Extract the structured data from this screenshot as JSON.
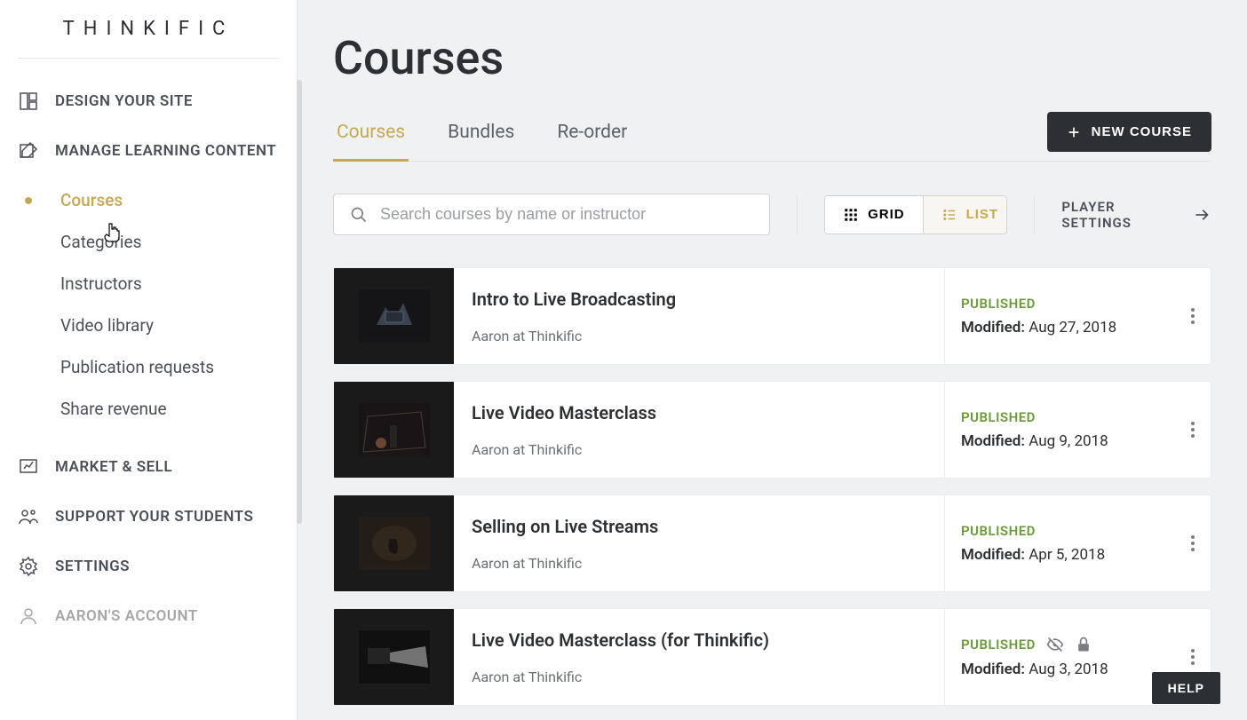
{
  "brand": "THINKIFIC",
  "sidebar": {
    "sections": [
      {
        "label": "DESIGN YOUR SITE"
      },
      {
        "label": "MANAGE LEARNING CONTENT"
      },
      {
        "label": "MARKET & SELL"
      },
      {
        "label": "SUPPORT YOUR STUDENTS"
      },
      {
        "label": "SETTINGS"
      },
      {
        "label": "AARON'S ACCOUNT"
      }
    ],
    "manage_sub": [
      {
        "label": "Courses"
      },
      {
        "label": "Categories"
      },
      {
        "label": "Instructors"
      },
      {
        "label": "Video library"
      },
      {
        "label": "Publication requests"
      },
      {
        "label": "Share revenue"
      }
    ]
  },
  "page": {
    "title": "Courses"
  },
  "tabs": [
    {
      "label": "Courses"
    },
    {
      "label": "Bundles"
    },
    {
      "label": "Re-order"
    }
  ],
  "new_course_label": "NEW COURSE",
  "search": {
    "placeholder": "Search courses by name or instructor"
  },
  "view": {
    "grid": "GRID",
    "list": "LIST"
  },
  "player_settings": "PLAYER SETTINGS",
  "modified_label": "Modified:",
  "courses": [
    {
      "title": "Intro to Live Broadcasting",
      "instructor": "Aaron at Thinkific",
      "status": "PUBLISHED",
      "modified": "Aug 27, 2018",
      "hidden": false,
      "locked": false
    },
    {
      "title": "Live Video Masterclass",
      "instructor": "Aaron at Thinkific",
      "status": "PUBLISHED",
      "modified": "Aug 9, 2018",
      "hidden": false,
      "locked": false
    },
    {
      "title": "Selling on Live Streams",
      "instructor": "Aaron at Thinkific",
      "status": "PUBLISHED",
      "modified": "Apr 5, 2018",
      "hidden": false,
      "locked": false
    },
    {
      "title": "Live Video Masterclass (for Thinkific)",
      "instructor": "Aaron at Thinkific",
      "status": "PUBLISHED",
      "modified": "Aug 3, 2018",
      "hidden": true,
      "locked": true
    }
  ],
  "help": "HELP"
}
